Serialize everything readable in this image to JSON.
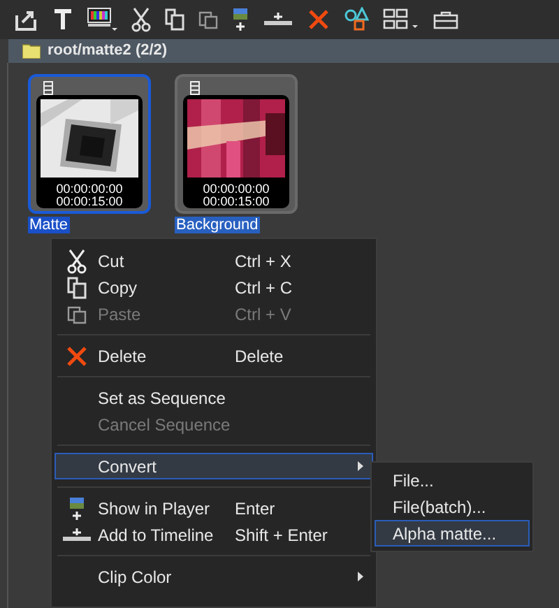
{
  "breadcrumb": {
    "path": "root/matte2 (2/2)"
  },
  "clips": [
    {
      "label": "Matte",
      "in": "00:00:00:00",
      "duration": "00:00:15:00",
      "selected": true
    },
    {
      "label": "Background",
      "in": "00:00:00:00",
      "duration": "00:00:15:00",
      "selected": false
    }
  ],
  "context_menu": {
    "sections": [
      [
        {
          "label": "Cut",
          "shortcut": "Ctrl + X",
          "disabled": false
        },
        {
          "label": "Copy",
          "shortcut": "Ctrl + C",
          "disabled": false
        },
        {
          "label": "Paste",
          "shortcut": "Ctrl + V",
          "disabled": true
        }
      ],
      [
        {
          "label": "Delete",
          "shortcut": "Delete",
          "disabled": false
        }
      ],
      [
        {
          "label": "Set as Sequence",
          "disabled": false
        },
        {
          "label": "Cancel Sequence",
          "disabled": true
        }
      ],
      [
        {
          "label": "Convert",
          "disabled": false,
          "selected": true,
          "submenu": true
        }
      ],
      [
        {
          "label": "Show in Player",
          "shortcut": "Enter",
          "disabled": false
        },
        {
          "label": "Add to Timeline",
          "shortcut": "Shift + Enter",
          "disabled": false
        }
      ],
      [
        {
          "label": "Clip Color",
          "disabled": false,
          "submenu": true
        }
      ]
    ]
  },
  "submenu": {
    "items": [
      {
        "label": "File...",
        "selected": false
      },
      {
        "label": "File(batch)...",
        "selected": false
      },
      {
        "label": "Alpha matte...",
        "selected": true
      }
    ]
  }
}
